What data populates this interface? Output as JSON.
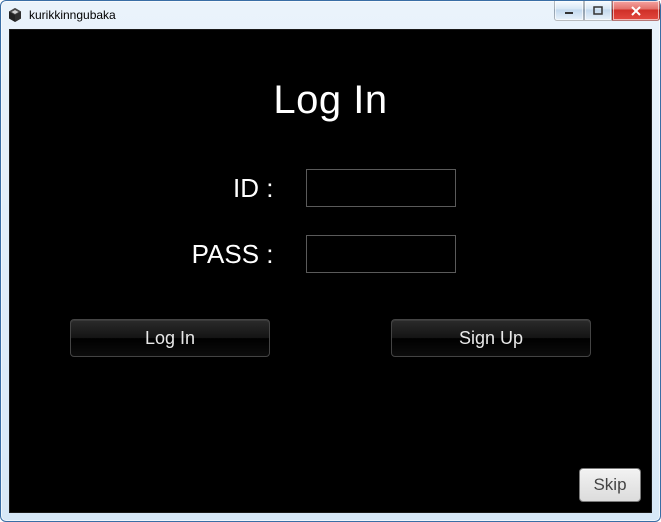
{
  "window": {
    "title": "kurikkinngubaka",
    "icon_name": "unity-icon"
  },
  "heading": "Log In",
  "form": {
    "id": {
      "label": "ID :",
      "value": ""
    },
    "pass": {
      "label": "PASS :",
      "value": ""
    }
  },
  "buttons": {
    "login": "Log In",
    "signup": "Sign Up",
    "skip": "Skip"
  },
  "colors": {
    "background": "#000000",
    "text": "#ffffff",
    "close": "#cf2f27"
  }
}
